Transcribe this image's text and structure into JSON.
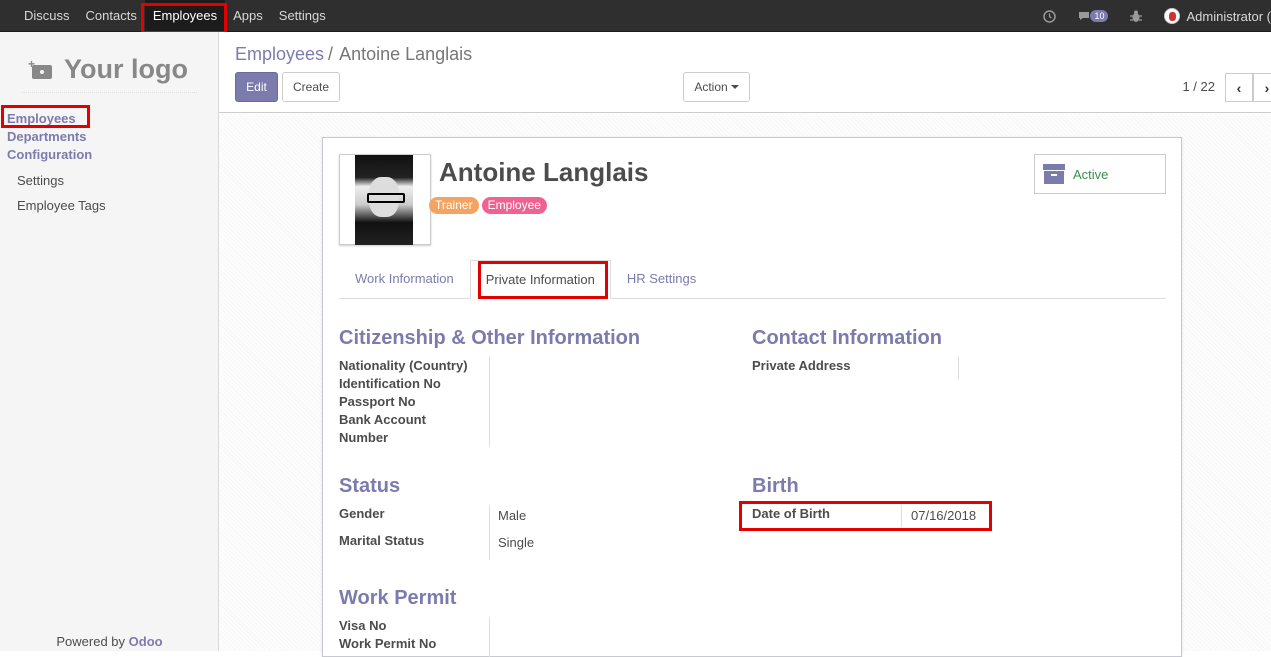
{
  "topbar": {
    "menu": [
      "Discuss",
      "Contacts",
      "Employees",
      "Apps",
      "Settings"
    ],
    "badge_count": "10",
    "user": "Administrator ("
  },
  "sidebar": {
    "logo_text": "Your logo",
    "items": {
      "employees": "Employees",
      "departments": "Departments",
      "configuration": "Configuration",
      "settings": "Settings",
      "employee_tags": "Employee Tags"
    },
    "powered_by": "Powered by ",
    "powered_brand": "Odoo"
  },
  "control_panel": {
    "breadcrumb_parent": "Employees",
    "breadcrumb_sep": "/",
    "breadcrumb_current": "Antoine Langlais",
    "edit_label": "Edit",
    "create_label": "Create",
    "action_label": "Action",
    "pager": "1 / 22",
    "prev_symbol": "‹",
    "next_symbol": "›"
  },
  "employee": {
    "name": "Antoine Langlais",
    "tags": [
      {
        "label": "Trainer",
        "color": "#f4a460"
      },
      {
        "label": "Employee",
        "color": "#f06292"
      }
    ],
    "status_button": "Active"
  },
  "tabs": [
    "Work Information",
    "Private Information",
    "HR Settings"
  ],
  "sections": {
    "citizenship": {
      "title": "Citizenship & Other Information",
      "fields": [
        "Nationality (Country)",
        "Identification No",
        "Passport No",
        "Bank Account",
        "Number"
      ]
    },
    "contact": {
      "title": "Contact Information",
      "fields": [
        "Private Address"
      ]
    },
    "status": {
      "title": "Status",
      "gender_label": "Gender",
      "gender_value": "Male",
      "marital_label": "Marital Status",
      "marital_value": "Single"
    },
    "birth": {
      "title": "Birth",
      "dob_label": "Date of Birth",
      "dob_value": "07/16/2018"
    },
    "work_permit": {
      "title": "Work Permit",
      "fields": [
        "Visa No",
        "Work Permit No"
      ]
    }
  },
  "colors": {
    "brand": "#7c7bad",
    "topbar": "#2f2f2f",
    "highlight": "#e30000"
  }
}
